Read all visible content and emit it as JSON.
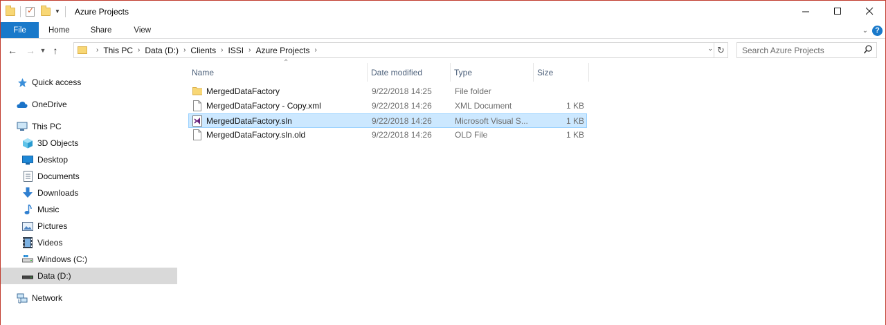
{
  "window": {
    "title": "Azure Projects"
  },
  "ribbon": {
    "tabs": [
      "File",
      "Home",
      "Share",
      "View"
    ]
  },
  "address": {
    "crumbs": [
      "This PC",
      "Data (D:)",
      "Clients",
      "ISSI",
      "Azure Projects"
    ]
  },
  "search": {
    "placeholder": "Search Azure Projects"
  },
  "nav": {
    "items": [
      {
        "label": "Quick access",
        "icon": "star-icon"
      },
      {
        "label": "OneDrive",
        "icon": "cloud-icon"
      },
      {
        "label": "This PC",
        "icon": "computer-icon"
      },
      {
        "label": "3D Objects",
        "icon": "cube-icon"
      },
      {
        "label": "Desktop",
        "icon": "desktop-icon"
      },
      {
        "label": "Documents",
        "icon": "document-icon"
      },
      {
        "label": "Downloads",
        "icon": "download-icon"
      },
      {
        "label": "Music",
        "icon": "music-icon"
      },
      {
        "label": "Pictures",
        "icon": "picture-icon"
      },
      {
        "label": "Videos",
        "icon": "video-icon"
      },
      {
        "label": "Windows (C:)",
        "icon": "drive-icon"
      },
      {
        "label": "Data (D:)",
        "icon": "drive-icon"
      },
      {
        "label": "Network",
        "icon": "network-icon"
      }
    ]
  },
  "columns": {
    "name": "Name",
    "date": "Date modified",
    "type": "Type",
    "size": "Size"
  },
  "files": [
    {
      "name": "MergedDataFactory",
      "date": "9/22/2018 14:25",
      "type": "File folder",
      "size": "",
      "icon": "folder-icon"
    },
    {
      "name": "MergedDataFactory - Copy.xml",
      "date": "9/22/2018 14:26",
      "type": "XML Document",
      "size": "1 KB",
      "icon": "file-icon"
    },
    {
      "name": "MergedDataFactory.sln",
      "date": "9/22/2018 14:26",
      "type": "Microsoft Visual S...",
      "size": "1 KB",
      "icon": "visual-studio-icon"
    },
    {
      "name": "MergedDataFactory.sln.old",
      "date": "9/22/2018 14:26",
      "type": "OLD File",
      "size": "1 KB",
      "icon": "file-icon"
    }
  ],
  "colors": {
    "accent": "#1979ca",
    "selection": "#cce8ff",
    "folder": "#f8d775"
  }
}
